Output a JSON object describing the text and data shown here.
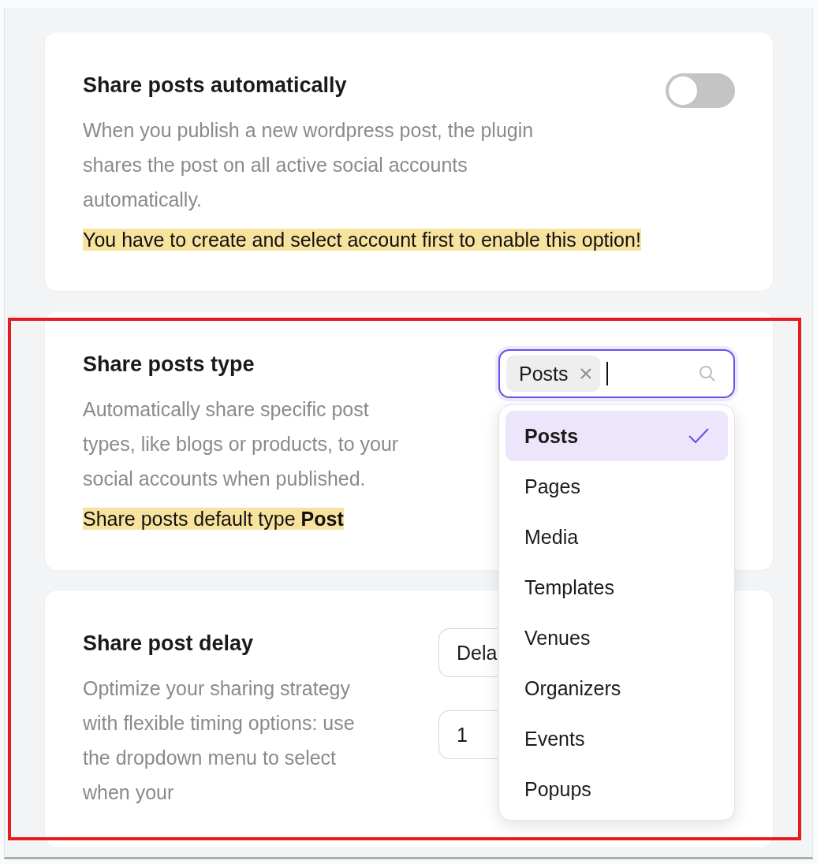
{
  "cards": [
    {
      "kind": "toggle",
      "title": "Share posts automatically",
      "description": "When you publish a new wordpress post, the plugin shares the post on all active social accounts automatically.",
      "on": false,
      "notice": "You have to create and select account first to enable this option!"
    },
    {
      "kind": "multiselect",
      "title": "Share posts type",
      "description": "Automatically share specific post types, like blogs or products, to your social accounts when published.",
      "notice": "Share posts default type **Post**",
      "tags": [
        {
          "label": "Posts"
        }
      ],
      "options": [
        {
          "label": "Posts",
          "selected": true
        },
        {
          "label": "Pages",
          "selected": false
        },
        {
          "label": "Media",
          "selected": false
        },
        {
          "label": "Templates",
          "selected": false
        },
        {
          "label": "Venues",
          "selected": false
        },
        {
          "label": "Organizers",
          "selected": false
        },
        {
          "label": "Events",
          "selected": false
        },
        {
          "label": "Popups",
          "selected": false
        }
      ]
    },
    {
      "kind": "delay",
      "title": "Share post delay",
      "description": "Optimize your sharing strategy with flexible timing options: use the dropdown menu to select when your",
      "select_value": "Dela",
      "input_value": "1"
    }
  ]
}
